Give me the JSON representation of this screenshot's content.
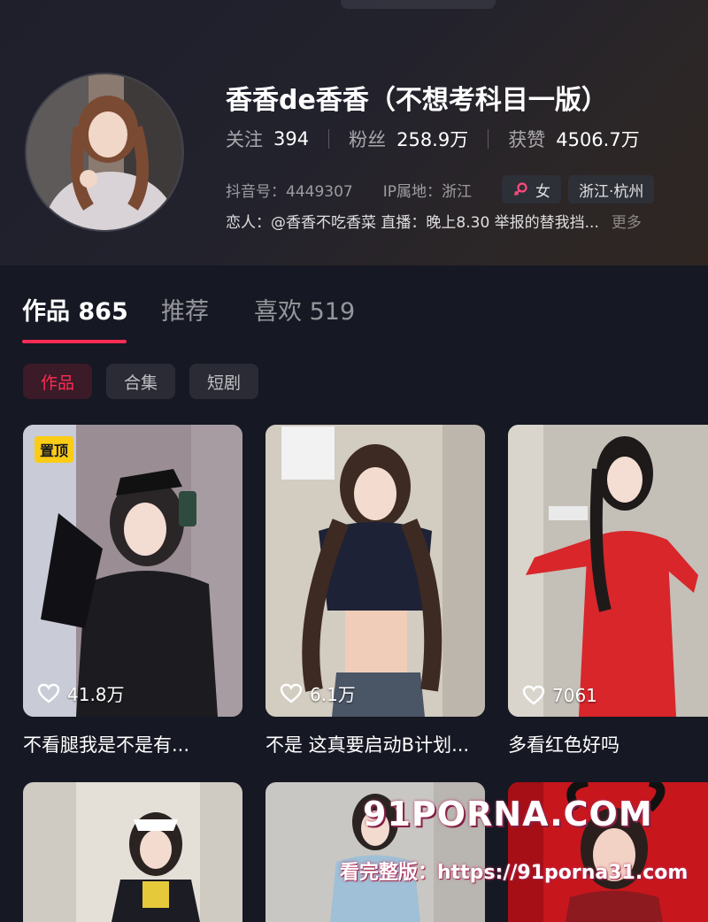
{
  "profile": {
    "name": "香香de香香（不想考科目一版）",
    "stats": [
      {
        "label": "关注",
        "value": "394"
      },
      {
        "label": "粉丝",
        "value": "258.9万"
      },
      {
        "label": "获赞",
        "value": "4506.7万"
      }
    ],
    "douyin_id": "抖音号：4449307",
    "ip_location": "IP属地：浙江",
    "gender_tag": "女",
    "region_tag": "浙江·杭州",
    "bio": "恋人：@香香不吃香菜 直播：晚上8.30 举报的替我挡...",
    "more_label": "更多"
  },
  "tabs": [
    {
      "label": "作品 865",
      "active": true
    },
    {
      "label": "推荐",
      "active": false
    },
    {
      "label": "喜欢 519",
      "active": false
    }
  ],
  "filters": [
    {
      "label": "作品",
      "active": true
    },
    {
      "label": "合集",
      "active": false
    },
    {
      "label": "短剧",
      "active": false
    }
  ],
  "videos": [
    {
      "pinned_label": "置顶",
      "likes": "41.8万",
      "caption": "不看腿我是不是有..."
    },
    {
      "likes": "6.1万",
      "caption": "不是 这真要启动B计划..."
    },
    {
      "likes": "7061",
      "caption": "多看红色好吗"
    }
  ],
  "watermark": {
    "logo": "91PORNA.COM",
    "text": "看完整版：https://91porna31.com"
  },
  "colors": {
    "background": "#161823",
    "accent": "#fe2c55",
    "pin_badge": "#facc15"
  }
}
